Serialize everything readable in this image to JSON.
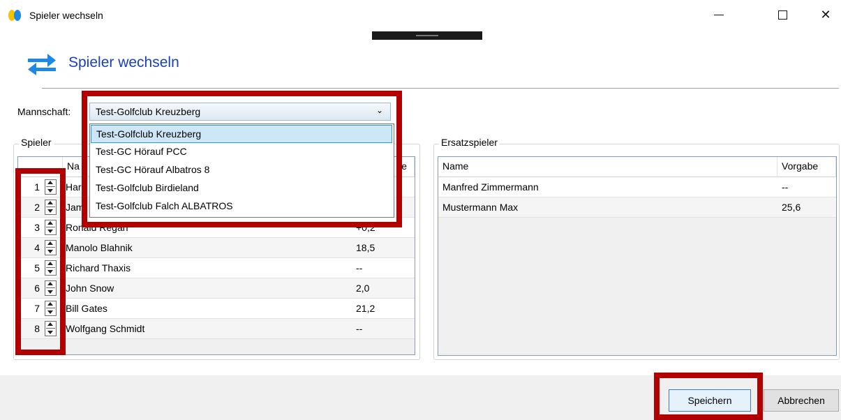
{
  "window": {
    "title": "Spieler wechseln"
  },
  "header": {
    "title": "Spieler wechseln",
    "icon": "swap-arrows-icon"
  },
  "team": {
    "label": "Mannschaft:",
    "selected": "Test-Golfclub Kreuzberg",
    "options": [
      "Test-Golfclub Kreuzberg",
      "Test-GC Hörauf PCC",
      "Test-GC Hörauf Albatros 8",
      "Test-Golfclub Birdieland",
      "Test-Golfclub Falch ALBATROS"
    ]
  },
  "players": {
    "legend": "Spieler",
    "headers": {
      "name": "Na",
      "hcp": "e"
    },
    "rows": [
      {
        "pos": "1",
        "name": "Har",
        "hcp": ""
      },
      {
        "pos": "2",
        "name": "Jam",
        "hcp": ""
      },
      {
        "pos": "3",
        "name": "Ronald Regan",
        "hcp": "+0,2"
      },
      {
        "pos": "4",
        "name": "Manolo Blahnik",
        "hcp": "18,5"
      },
      {
        "pos": "5",
        "name": "Richard Thaxis",
        "hcp": "--"
      },
      {
        "pos": "6",
        "name": "John Snow",
        "hcp": "2,0"
      },
      {
        "pos": "7",
        "name": "Bill Gates",
        "hcp": "21,2"
      },
      {
        "pos": "8",
        "name": "Wolfgang Schmidt",
        "hcp": "--"
      }
    ]
  },
  "substitutes": {
    "legend": "Ersatzspieler",
    "headers": {
      "name": "Name",
      "hcp": "Vorgabe"
    },
    "rows": [
      {
        "name": "Manfred Zimmermann",
        "hcp": "--"
      },
      {
        "name": "Mustermann Max",
        "hcp": "25,6"
      }
    ]
  },
  "buttons": {
    "save": "Speichern",
    "cancel": "Abbrechen"
  },
  "colors": {
    "title_blue": "#1740c4",
    "highlight_red": "#b10000",
    "selection_blue": "#cde6f8",
    "icon_blue": "#1e88e5"
  }
}
